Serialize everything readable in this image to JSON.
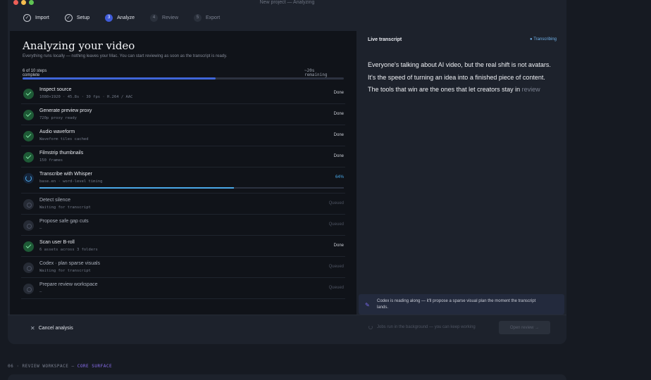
{
  "window": {
    "title": "New project — Analyzing",
    "dots": [
      "#ee5f57",
      "#f5bd4f",
      "#5fc453"
    ]
  },
  "stepper": [
    {
      "badge": "✓",
      "label": "Import",
      "state": "done"
    },
    {
      "badge": "✓",
      "label": "Setup",
      "state": "done"
    },
    {
      "badge": "3",
      "label": "Analyze",
      "state": "active"
    },
    {
      "badge": "4",
      "label": "Review",
      "state": "pending"
    },
    {
      "badge": "5",
      "label": "Export",
      "state": "pending"
    }
  ],
  "analysis": {
    "title": "Analyzing your video",
    "subtitle": "Everything runs locally — nothing leaves your Mac. You can start reviewing as soon as the transcript is ready.",
    "steps_count": "6 of 10 steps complete",
    "remaining": "~20s remaining",
    "progress": 0.6,
    "accent": "#3f65d8"
  },
  "tasks": [
    {
      "title": "Inspect source",
      "sub": "1080×1920 · 45.8s · 30 fps · H.264 / AAC",
      "status": "Done",
      "state": "done"
    },
    {
      "title": "Generate preview proxy",
      "sub": "720p proxy ready",
      "status": "Done",
      "state": "done"
    },
    {
      "title": "Audio waveform",
      "sub": "Waveform tiles cached",
      "status": "Done",
      "state": "done"
    },
    {
      "title": "Filmstrip thumbnails",
      "sub": "150 frames",
      "status": "Done",
      "state": "done"
    },
    {
      "title": "Transcribe with Whisper",
      "sub": "base.en · word-level timing",
      "status": "64%",
      "state": "running",
      "progress": 0.64
    },
    {
      "title": "Detect silence",
      "sub": "Waiting for transcript",
      "status": "Queued",
      "state": "queued"
    },
    {
      "title": "Propose safe gap cuts",
      "sub": "—",
      "status": "Queued",
      "state": "queued"
    },
    {
      "title": "Scan user B-roll",
      "sub": "6 assets across 3 folders",
      "status": "Done",
      "state": "done"
    },
    {
      "title": "Codex · plan sparse visuals",
      "sub": "Waiting for transcript",
      "status": "Queued",
      "state": "queued"
    },
    {
      "title": "Prepare review workspace",
      "sub": "—",
      "status": "Queued",
      "state": "queued"
    }
  ],
  "live": {
    "label": "Live transcript",
    "status": "Transcribing",
    "status_icon": "pulse-dot-icon",
    "text": "Everyone's talking about AI video, but the real shift is not avatars. It's the speed of turning an idea into a finished piece of content. The tools that win are the ones that let creators stay in ",
    "faded": "review"
  },
  "codex": {
    "icon": "sparkle-icon",
    "text": "Codex is reading along — it'll propose a sparse visual plan the moment the transcript lands."
  },
  "footer": {
    "cancel_label": "Cancel analysis",
    "background_note": "Jobs run in the background — you can keep working",
    "open_review_label": "Open review →"
  },
  "section_caption": {
    "prefix": "06 · REVIEW WORKSPACE — ",
    "accent": "CORE SURFACE"
  }
}
